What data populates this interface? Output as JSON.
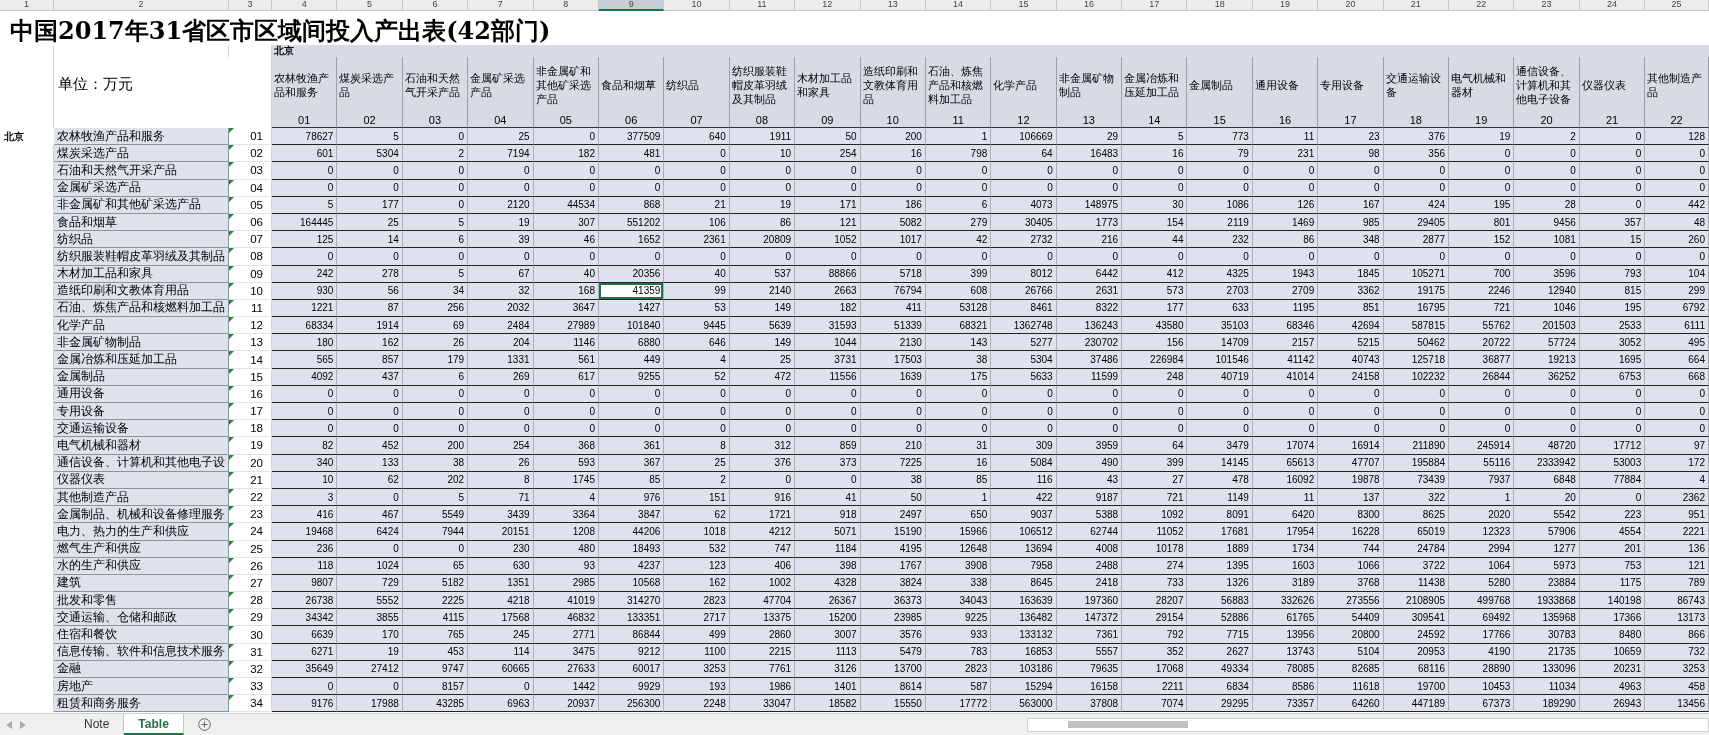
{
  "column_numbers": [
    {
      "label": "1",
      "selected": false
    },
    {
      "label": "2",
      "selected": false
    },
    {
      "label": "3",
      "selected": false
    },
    {
      "label": "4",
      "selected": false
    },
    {
      "label": "5",
      "selected": false
    },
    {
      "label": "6",
      "selected": false
    },
    {
      "label": "7",
      "selected": false
    },
    {
      "label": "8",
      "selected": false
    },
    {
      "label": "9",
      "selected": true
    },
    {
      "label": "10",
      "selected": false
    },
    {
      "label": "11",
      "selected": false
    },
    {
      "label": "12",
      "selected": false
    },
    {
      "label": "13",
      "selected": false
    },
    {
      "label": "14",
      "selected": false
    },
    {
      "label": "15",
      "selected": false
    },
    {
      "label": "16",
      "selected": false
    },
    {
      "label": "17",
      "selected": false
    },
    {
      "label": "18",
      "selected": false
    },
    {
      "label": "19",
      "selected": false
    },
    {
      "label": "20",
      "selected": false
    },
    {
      "label": "21",
      "selected": false
    },
    {
      "label": "22",
      "selected": false
    },
    {
      "label": "23",
      "selected": false
    },
    {
      "label": "24",
      "selected": false
    },
    {
      "label": "25",
      "selected": false
    }
  ],
  "title": "中国2017年31省区市区域间投入产出表(42部门)",
  "region_header": "北京",
  "unit": "单位：万元",
  "columns": [
    {
      "name": "农林牧渔产品和服务",
      "code": "01"
    },
    {
      "name": "煤炭采选产品",
      "code": "02"
    },
    {
      "name": "石油和天然气开采产品",
      "code": "03"
    },
    {
      "name": "金属矿采选产品",
      "code": "04"
    },
    {
      "name": "非金属矿和其他矿采选产品",
      "code": "05"
    },
    {
      "name": "食品和烟草",
      "code": "06"
    },
    {
      "name": "纺织品",
      "code": "07"
    },
    {
      "name": "纺织服装鞋帽皮革羽绒及其制品",
      "code": "08"
    },
    {
      "name": "木材加工品和家具",
      "code": "09"
    },
    {
      "name": "造纸印刷和文教体育用品",
      "code": "10"
    },
    {
      "name": "石油、炼焦产品和核燃料加工品",
      "code": "11"
    },
    {
      "name": "化学产品",
      "code": "12"
    },
    {
      "name": "非金属矿物制品",
      "code": "13"
    },
    {
      "name": "金属冶炼和压延加工品",
      "code": "14"
    },
    {
      "name": "金属制品",
      "code": "15"
    },
    {
      "name": "通用设备",
      "code": "16"
    },
    {
      "name": "专用设备",
      "code": "17"
    },
    {
      "name": "交通运输设备",
      "code": "18"
    },
    {
      "name": "电气机械和器材",
      "code": "19"
    },
    {
      "name": "通信设备、计算机和其他电子设备",
      "code": "20"
    },
    {
      "name": "仪器仪表",
      "code": "21"
    },
    {
      "name": "其他制造产品",
      "code": "22"
    }
  ],
  "rows": [
    {
      "region": "北京",
      "name": "农林牧渔产品和服务",
      "code": "01",
      "selected": false,
      "cells": [
        "78627",
        "5",
        "0",
        "25",
        "0",
        "377509",
        "640",
        "1911",
        "50",
        "200",
        "1",
        "106669",
        "29",
        "5",
        "773",
        "11",
        "23",
        "376",
        "19",
        "2",
        "0",
        "128"
      ]
    },
    {
      "name": "煤炭采选产品",
      "code": "02",
      "selected": false,
      "cells": [
        "601",
        "5304",
        "2",
        "7194",
        "182",
        "481",
        "0",
        "10",
        "254",
        "16",
        "798",
        "64",
        "16483",
        "16",
        "79",
        "231",
        "98",
        "356",
        "0",
        "0",
        "0",
        "0"
      ]
    },
    {
      "name": "石油和天然气开采产品",
      "code": "03",
      "selected": false,
      "cells": [
        "0",
        "0",
        "0",
        "0",
        "0",
        "0",
        "0",
        "0",
        "0",
        "0",
        "0",
        "0",
        "0",
        "0",
        "0",
        "0",
        "0",
        "0",
        "0",
        "0",
        "0",
        "0"
      ]
    },
    {
      "name": "金属矿采选产品",
      "code": "04",
      "selected": false,
      "cells": [
        "0",
        "0",
        "0",
        "0",
        "0",
        "0",
        "0",
        "0",
        "0",
        "0",
        "0",
        "0",
        "0",
        "0",
        "0",
        "0",
        "0",
        "0",
        "0",
        "0",
        "0",
        "0"
      ]
    },
    {
      "name": "非金属矿和其他矿采选产品",
      "code": "05",
      "selected": false,
      "cells": [
        "5",
        "177",
        "0",
        "2120",
        "44534",
        "868",
        "21",
        "19",
        "171",
        "186",
        "6",
        "4073",
        "148975",
        "30",
        "1086",
        "126",
        "167",
        "424",
        "195",
        "28",
        "0",
        "442"
      ]
    },
    {
      "name": "食品和烟草",
      "code": "06",
      "selected": false,
      "cells": [
        "164445",
        "25",
        "5",
        "19",
        "307",
        "551202",
        "106",
        "86",
        "121",
        "5082",
        "279",
        "30405",
        "1773",
        "154",
        "2119",
        "1469",
        "985",
        "29405",
        "801",
        "9456",
        "357",
        "48"
      ]
    },
    {
      "name": "纺织品",
      "code": "07",
      "selected": false,
      "cells": [
        "125",
        "14",
        "6",
        "39",
        "46",
        "1652",
        "2361",
        "20809",
        "1052",
        "1017",
        "42",
        "2732",
        "216",
        "44",
        "232",
        "86",
        "348",
        "2877",
        "152",
        "1081",
        "15",
        "260"
      ]
    },
    {
      "name": "纺织服装鞋帽皮革羽绒及其制品",
      "code": "08",
      "selected": false,
      "cells": [
        "0",
        "0",
        "0",
        "0",
        "0",
        "0",
        "0",
        "0",
        "0",
        "0",
        "0",
        "0",
        "0",
        "0",
        "0",
        "0",
        "0",
        "0",
        "0",
        "0",
        "0",
        "0"
      ]
    },
    {
      "name": "木材加工品和家具",
      "code": "09",
      "selected": false,
      "cells": [
        "242",
        "278",
        "5",
        "67",
        "40",
        "20356",
        "40",
        "537",
        "88866",
        "5718",
        "399",
        "8012",
        "6442",
        "412",
        "4325",
        "1943",
        "1845",
        "105271",
        "700",
        "3596",
        "793",
        "104"
      ]
    },
    {
      "name": "造纸印刷和文教体育用品",
      "code": "10",
      "selected": true,
      "cells": [
        "930",
        "56",
        "34",
        "32",
        "168",
        "41359",
        "99",
        "2140",
        "2663",
        "76794",
        "608",
        "26766",
        "2631",
        "573",
        "2703",
        "2709",
        "3362",
        "19175",
        "2246",
        "12940",
        "815",
        "299"
      ]
    },
    {
      "name": "石油、炼焦产品和核燃料加工品",
      "code": "11",
      "selected": false,
      "cells": [
        "1221",
        "87",
        "256",
        "2032",
        "3647",
        "1427",
        "53",
        "149",
        "182",
        "411",
        "53128",
        "8461",
        "8322",
        "177",
        "633",
        "1195",
        "851",
        "16795",
        "721",
        "1046",
        "195",
        "6792"
      ]
    },
    {
      "name": "化学产品",
      "code": "12",
      "selected": false,
      "cells": [
        "68334",
        "1914",
        "69",
        "2484",
        "27989",
        "101840",
        "9445",
        "5639",
        "31593",
        "51339",
        "68321",
        "1362748",
        "136243",
        "43580",
        "35103",
        "68346",
        "42694",
        "587815",
        "55762",
        "201503",
        "2533",
        "6111"
      ]
    },
    {
      "name": "非金属矿物制品",
      "code": "13",
      "selected": false,
      "cells": [
        "180",
        "162",
        "26",
        "204",
        "1146",
        "6880",
        "646",
        "149",
        "1044",
        "2130",
        "143",
        "5277",
        "230702",
        "156",
        "14709",
        "2157",
        "5215",
        "50462",
        "20722",
        "57724",
        "3052",
        "495"
      ]
    },
    {
      "name": "金属冶炼和压延加工品",
      "code": "14",
      "selected": false,
      "cells": [
        "565",
        "857",
        "179",
        "1331",
        "561",
        "449",
        "4",
        "25",
        "3731",
        "17503",
        "38",
        "5304",
        "37486",
        "226984",
        "101546",
        "41142",
        "40743",
        "125718",
        "36877",
        "19213",
        "1695",
        "664"
      ]
    },
    {
      "name": "金属制品",
      "code": "15",
      "selected": false,
      "cells": [
        "4092",
        "437",
        "6",
        "269",
        "617",
        "9255",
        "52",
        "472",
        "11556",
        "1639",
        "175",
        "5633",
        "11599",
        "248",
        "40719",
        "41014",
        "24158",
        "102232",
        "26844",
        "36252",
        "6753",
        "668"
      ]
    },
    {
      "name": "通用设备",
      "code": "16",
      "selected": false,
      "cells": [
        "0",
        "0",
        "0",
        "0",
        "0",
        "0",
        "0",
        "0",
        "0",
        "0",
        "0",
        "0",
        "0",
        "0",
        "0",
        "0",
        "0",
        "0",
        "0",
        "0",
        "0",
        "0"
      ]
    },
    {
      "name": "专用设备",
      "code": "17",
      "selected": false,
      "cells": [
        "0",
        "0",
        "0",
        "0",
        "0",
        "0",
        "0",
        "0",
        "0",
        "0",
        "0",
        "0",
        "0",
        "0",
        "0",
        "0",
        "0",
        "0",
        "0",
        "0",
        "0",
        "0"
      ]
    },
    {
      "name": "交通运输设备",
      "code": "18",
      "selected": false,
      "cells": [
        "0",
        "0",
        "0",
        "0",
        "0",
        "0",
        "0",
        "0",
        "0",
        "0",
        "0",
        "0",
        "0",
        "0",
        "0",
        "0",
        "0",
        "0",
        "0",
        "0",
        "0",
        "0"
      ]
    },
    {
      "name": "电气机械和器材",
      "code": "19",
      "selected": false,
      "cells": [
        "82",
        "452",
        "200",
        "254",
        "368",
        "361",
        "8",
        "312",
        "859",
        "210",
        "31",
        "309",
        "3959",
        "64",
        "3479",
        "17074",
        "16914",
        "211890",
        "245914",
        "48720",
        "17712",
        "97"
      ]
    },
    {
      "name": "通信设备、计算机和其他电子设",
      "code": "20",
      "selected": false,
      "cells": [
        "340",
        "133",
        "38",
        "26",
        "593",
        "367",
        "25",
        "376",
        "373",
        "7225",
        "16",
        "5084",
        "490",
        "399",
        "14145",
        "65613",
        "47707",
        "195884",
        "55116",
        "2333942",
        "53003",
        "172"
      ]
    },
    {
      "name": "仪器仪表",
      "code": "21",
      "selected": false,
      "cells": [
        "10",
        "62",
        "202",
        "8",
        "1745",
        "85",
        "2",
        "0",
        "0",
        "38",
        "85",
        "116",
        "43",
        "27",
        "478",
        "16092",
        "19878",
        "73439",
        "7937",
        "6848",
        "77884",
        "4"
      ]
    },
    {
      "name": "其他制造产品",
      "code": "22",
      "selected": false,
      "cells": [
        "3",
        "0",
        "5",
        "71",
        "4",
        "976",
        "151",
        "916",
        "41",
        "50",
        "1",
        "422",
        "9187",
        "721",
        "1149",
        "11",
        "137",
        "322",
        "1",
        "20",
        "0",
        "2362"
      ]
    },
    {
      "name": "金属制品、机械和设备修理服务",
      "code": "23",
      "selected": false,
      "cells": [
        "416",
        "467",
        "5549",
        "3439",
        "3364",
        "3847",
        "62",
        "1721",
        "918",
        "2497",
        "650",
        "9037",
        "5388",
        "1092",
        "8091",
        "6420",
        "8300",
        "8625",
        "2020",
        "5542",
        "223",
        "951"
      ]
    },
    {
      "name": "电力、热力的生产和供应",
      "code": "24",
      "selected": false,
      "cells": [
        "19468",
        "6424",
        "7944",
        "20151",
        "1208",
        "44206",
        "1018",
        "4212",
        "5071",
        "15190",
        "15966",
        "106512",
        "62744",
        "11052",
        "17681",
        "17954",
        "16228",
        "65019",
        "12323",
        "57906",
        "4554",
        "2221"
      ]
    },
    {
      "name": "燃气生产和供应",
      "code": "25",
      "selected": false,
      "cells": [
        "236",
        "0",
        "0",
        "230",
        "480",
        "18493",
        "532",
        "747",
        "1184",
        "4195",
        "12648",
        "13694",
        "4008",
        "10178",
        "1889",
        "1734",
        "744",
        "24784",
        "2994",
        "1277",
        "201",
        "136"
      ]
    },
    {
      "name": "水的生产和供应",
      "code": "26",
      "selected": false,
      "cells": [
        "118",
        "1024",
        "65",
        "630",
        "93",
        "4237",
        "123",
        "406",
        "398",
        "1767",
        "3908",
        "7958",
        "2488",
        "274",
        "1395",
        "1603",
        "1066",
        "3722",
        "1064",
        "5973",
        "753",
        "121"
      ]
    },
    {
      "name": "建筑",
      "code": "27",
      "selected": false,
      "cells": [
        "9807",
        "729",
        "5182",
        "1351",
        "2985",
        "10568",
        "162",
        "1002",
        "4328",
        "3824",
        "338",
        "8645",
        "2418",
        "733",
        "1326",
        "3189",
        "3768",
        "11438",
        "5280",
        "23884",
        "1175",
        "789"
      ]
    },
    {
      "name": "批发和零售",
      "code": "28",
      "selected": false,
      "cells": [
        "26738",
        "5552",
        "2225",
        "4218",
        "41019",
        "314270",
        "2823",
        "47704",
        "26367",
        "36373",
        "34043",
        "163639",
        "197360",
        "28207",
        "56883",
        "332626",
        "273556",
        "2108905",
        "499768",
        "1933868",
        "140198",
        "86743"
      ]
    },
    {
      "name": "交通运输、仓储和邮政",
      "code": "29",
      "selected": false,
      "cells": [
        "34342",
        "3855",
        "4115",
        "17568",
        "46832",
        "133351",
        "2717",
        "13375",
        "15200",
        "23985",
        "9225",
        "136482",
        "147372",
        "29154",
        "52886",
        "61765",
        "54409",
        "309541",
        "69492",
        "135968",
        "17366",
        "13173"
      ]
    },
    {
      "name": "住宿和餐饮",
      "code": "30",
      "selected": false,
      "cells": [
        "6639",
        "170",
        "765",
        "245",
        "2771",
        "86844",
        "499",
        "2860",
        "3007",
        "3576",
        "933",
        "133132",
        "7361",
        "792",
        "7715",
        "13956",
        "20800",
        "24592",
        "17766",
        "30783",
        "8480",
        "866"
      ]
    },
    {
      "name": "信息传输、软件和信息技术服务",
      "code": "31",
      "selected": false,
      "cells": [
        "6271",
        "19",
        "453",
        "114",
        "3475",
        "9212",
        "1100",
        "2215",
        "1113",
        "5479",
        "783",
        "16853",
        "5557",
        "352",
        "2627",
        "13743",
        "5104",
        "20953",
        "4190",
        "21735",
        "10659",
        "732"
      ]
    },
    {
      "name": "金融",
      "code": "32",
      "selected": false,
      "cells": [
        "35649",
        "27412",
        "9747",
        "60665",
        "27633",
        "60017",
        "3253",
        "7761",
        "3126",
        "13700",
        "2823",
        "103186",
        "79635",
        "17068",
        "49334",
        "78085",
        "82685",
        "68116",
        "28890",
        "133096",
        "20231",
        "3253"
      ]
    },
    {
      "name": "房地产",
      "code": "33",
      "selected": false,
      "cells": [
        "0",
        "0",
        "8157",
        "0",
        "1442",
        "9929",
        "193",
        "1986",
        "1401",
        "8614",
        "587",
        "15294",
        "16158",
        "2211",
        "6834",
        "8586",
        "11618",
        "19700",
        "10453",
        "11034",
        "4963",
        "458"
      ]
    },
    {
      "name": "租赁和商务服务",
      "code": "34",
      "selected": false,
      "cells": [
        "9176",
        "17988",
        "43285",
        "6963",
        "20937",
        "256300",
        "2248",
        "33047",
        "18582",
        "15550",
        "17772",
        "563000",
        "37808",
        "7074",
        "29295",
        "73357",
        "64260",
        "447189",
        "67373",
        "189290",
        "26943",
        "13456"
      ]
    }
  ],
  "sheet_tabs": [
    {
      "label": "Note",
      "selected": false
    },
    {
      "label": "Table",
      "selected": true
    }
  ]
}
